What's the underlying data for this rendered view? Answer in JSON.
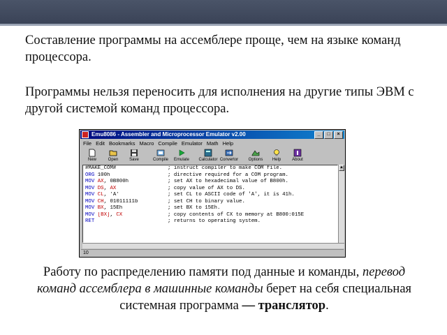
{
  "slide": {
    "p1": "Составление программы на ассемблере проще, чем на языке команд процессора.",
    "p2": "Программы нельзя переносить для исполнения на другие типы ЭВМ с другой системой команд процессора.",
    "p3_part1": "Работу по распределению памяти под данные и команды, ",
    "p3_em": "перевод команд ассемблера в машинные команды",
    "p3_part2": " берет на себя специальная системная программа ",
    "p3_strong": "— транслятор",
    "p3_end": "."
  },
  "emulator": {
    "title": "Emu8086 - Assembler and Microprocessor Emulator v2.00",
    "window_buttons": {
      "minimize": "_",
      "maximize": "□",
      "close": "×"
    },
    "menu": [
      "File",
      "Edit",
      "Bookmarks",
      "Macro",
      "Compile",
      "Emulator",
      "Math",
      "Help"
    ],
    "toolbar": [
      "New",
      "Open",
      "Save",
      "Compile",
      "Emulate",
      "Calculator",
      "Convertor",
      "Options",
      "Help",
      "About"
    ],
    "status": "10",
    "code": [
      {
        "op": "#MAKE_COM#",
        "args": "",
        "comment": "; instruct compiler to make COM file."
      },
      {
        "op": "ORG",
        "args": "100h",
        "comment": "; directive required for a COM program."
      },
      {
        "op": "MOV",
        "reg": "AX",
        "args": ", 0B800h",
        "comment": "; set AX to hexadecimal value of B800h."
      },
      {
        "op": "MOV",
        "reg": "DS",
        "args2": "AX",
        "comment": "; copy value of AX to DS."
      },
      {
        "op": "MOV",
        "reg": "CL",
        "args": ", 'A'",
        "comment": "; set CL to ASCII code of 'A', it is 41h."
      },
      {
        "op": "MOV",
        "reg": "CH",
        "args": ", 01011111b",
        "comment": "; set CH to binary value."
      },
      {
        "op": "MOV",
        "reg": "BX",
        "args": ", 15Eh",
        "comment": "; set BX to 15Eh."
      },
      {
        "op": "MOV",
        "reg": "[BX]",
        "args2": "CX",
        "comment": "; copy contents of CX to memory at B800:015E"
      },
      {
        "op": "RET",
        "args": "",
        "comment": "; returns to operating system."
      }
    ]
  },
  "colors": {
    "topbar": "#3a4357",
    "keyword": "#0000c0",
    "register": "#c00000",
    "titlebar": "#000a80"
  }
}
